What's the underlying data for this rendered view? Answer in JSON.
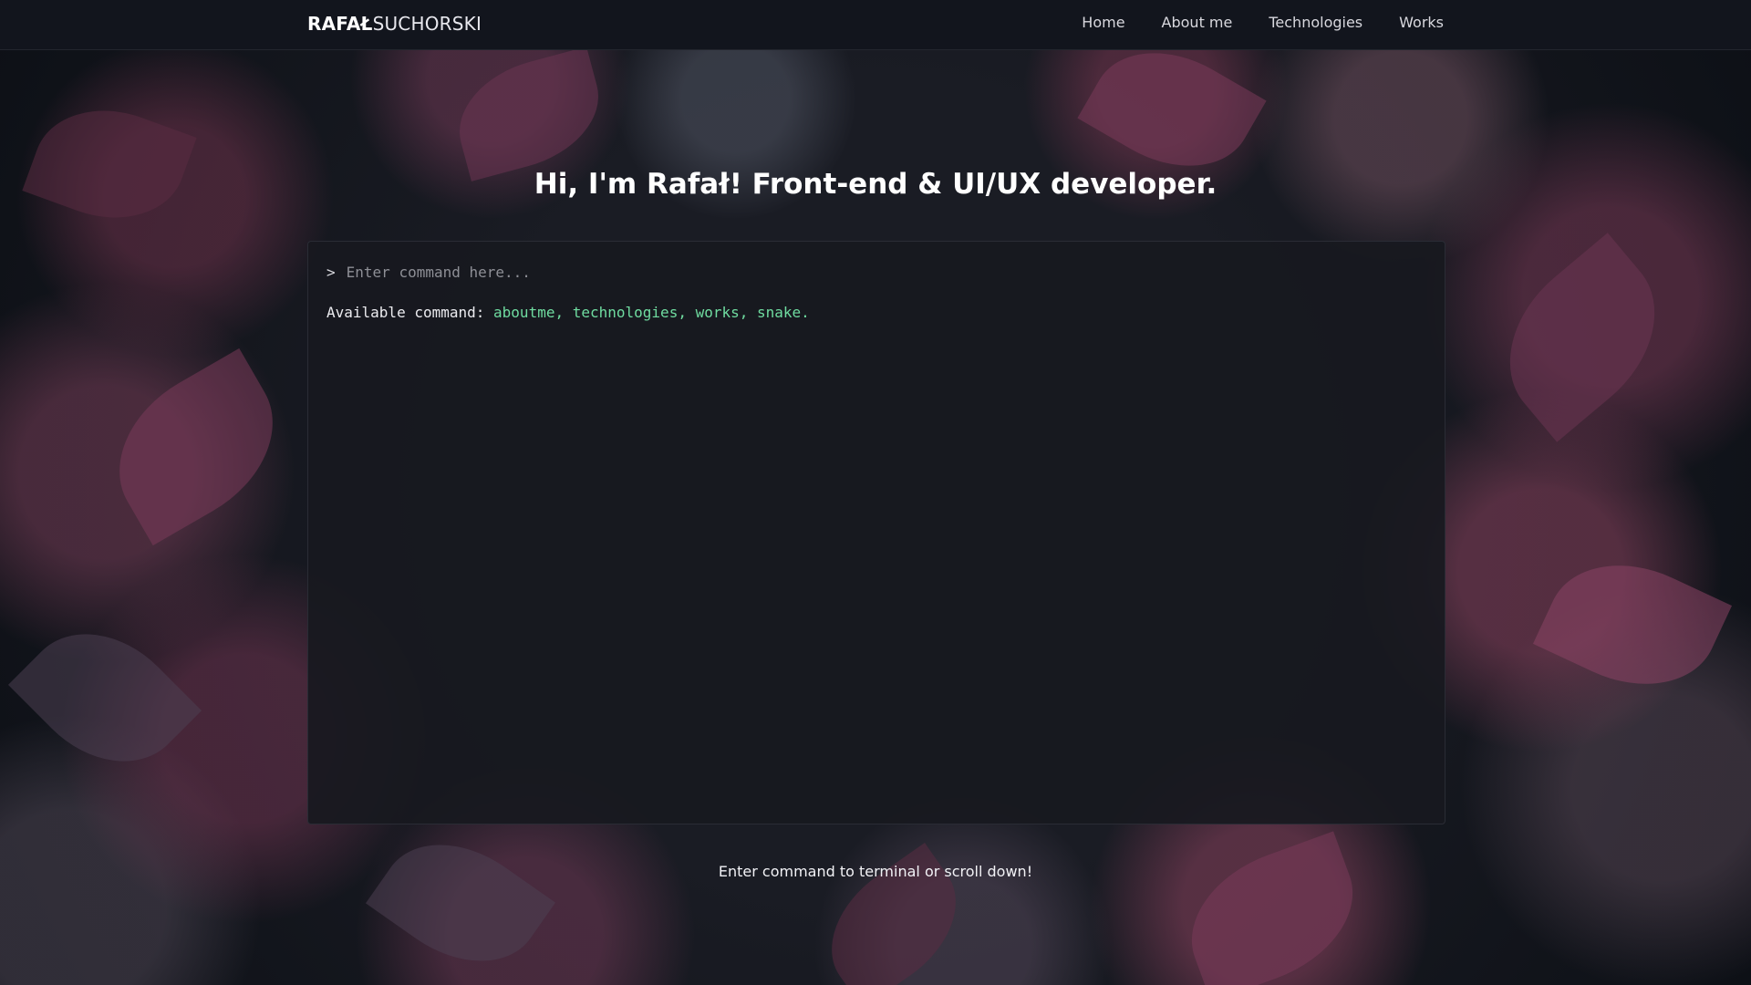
{
  "navbar": {
    "brand_bold": "RAFAŁ",
    "brand_light": "SUCHORSKI",
    "links": [
      "Home",
      "About me",
      "Technologies",
      "Works"
    ]
  },
  "hero": {
    "headline": "Hi, I'm Rafał! Front-end & UI/UX developer."
  },
  "terminal": {
    "prompt": ">",
    "placeholder": "Enter command here...",
    "available_label": "Available command:",
    "available_commands": "aboutme, technologies, works, snake."
  },
  "footer": {
    "hint": "Enter command to terminal or scroll down!"
  },
  "colors": {
    "accent_green": "#6fdca0",
    "navbar_bg": "#12151d",
    "terminal_bg": "#18191f"
  }
}
